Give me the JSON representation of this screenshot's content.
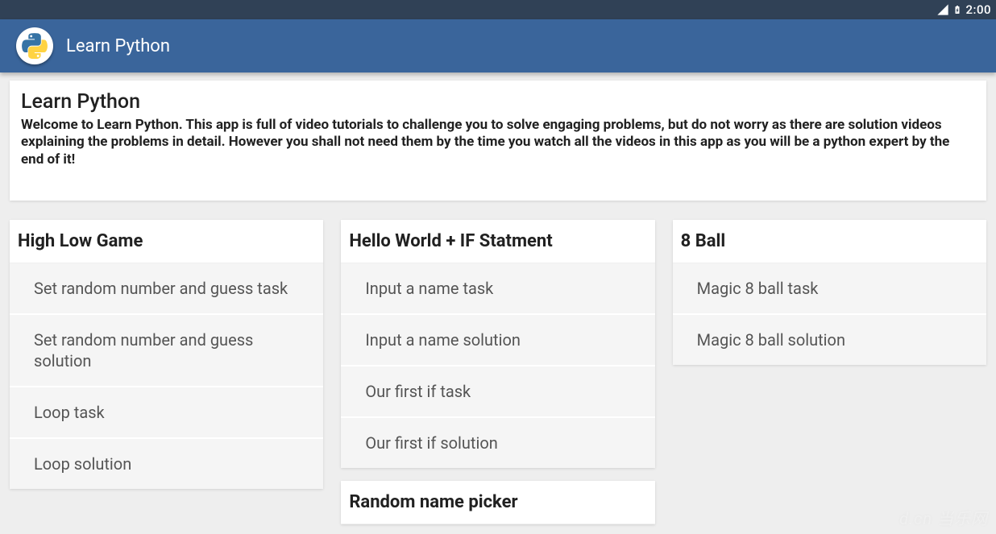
{
  "status": {
    "time": "2:00"
  },
  "app": {
    "title": "Learn Python"
  },
  "hero": {
    "heading": "Learn Python",
    "body": "Welcome to Learn Python. This app is full of video tutorials to challenge you to solve engaging problems, but do not worry as there are solution videos explaining the problems in detail. However you shall not need them by the time you watch all the videos in this app as you will be a python expert by the end of it!"
  },
  "columns": [
    {
      "title": "High Low Game",
      "items": [
        "Set random number and guess task",
        "Set random number and guess solution",
        "Loop task",
        "Loop solution"
      ]
    },
    {
      "title": "Hello World + IF Statment",
      "items": [
        "Input a name task",
        "Input a name solution",
        "Our first if task",
        "Our first if solution"
      ]
    },
    {
      "title": "8 Ball",
      "items": [
        "Magic 8 ball task",
        "Magic 8 ball solution"
      ]
    }
  ],
  "extra_card_col2_title": "Random name picker",
  "watermark": "d.cn 当乐网"
}
